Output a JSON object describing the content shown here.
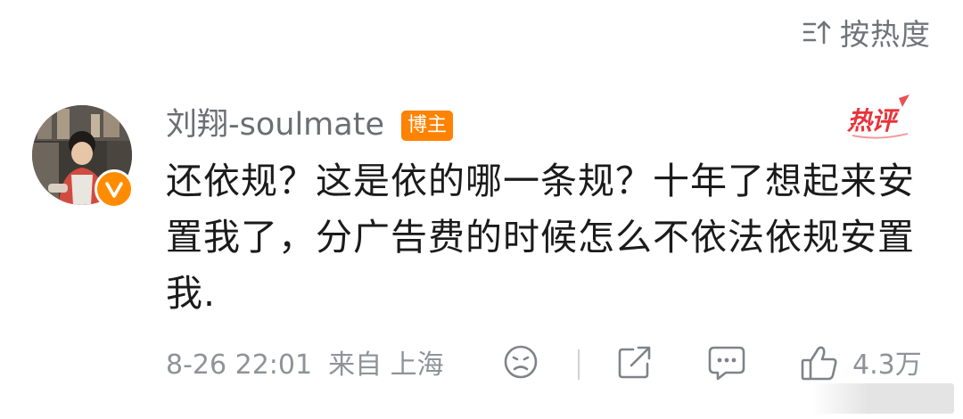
{
  "sort": {
    "label": "按热度"
  },
  "comment": {
    "username": "刘翔-soulmate",
    "badge": "博主",
    "hot_tag": "热评",
    "text": "还依规？这是依的哪一条规？十年了想起来安置我了，分广告费的时候怎么不依法依规安置我.",
    "date": "8-26 22:01",
    "location": "来自 上海",
    "like_count": "4.3万"
  },
  "colors": {
    "accent_orange": "#ff8200",
    "hot_red": "#e8333a",
    "meta_gray": "#8f9399",
    "text_dark": "#1b1b1b"
  },
  "icons": {
    "sort": "sort-icon",
    "verified": "verified-icon",
    "emoji": "emoji-icon",
    "share": "share-icon",
    "comment": "comment-icon",
    "like": "like-icon"
  }
}
